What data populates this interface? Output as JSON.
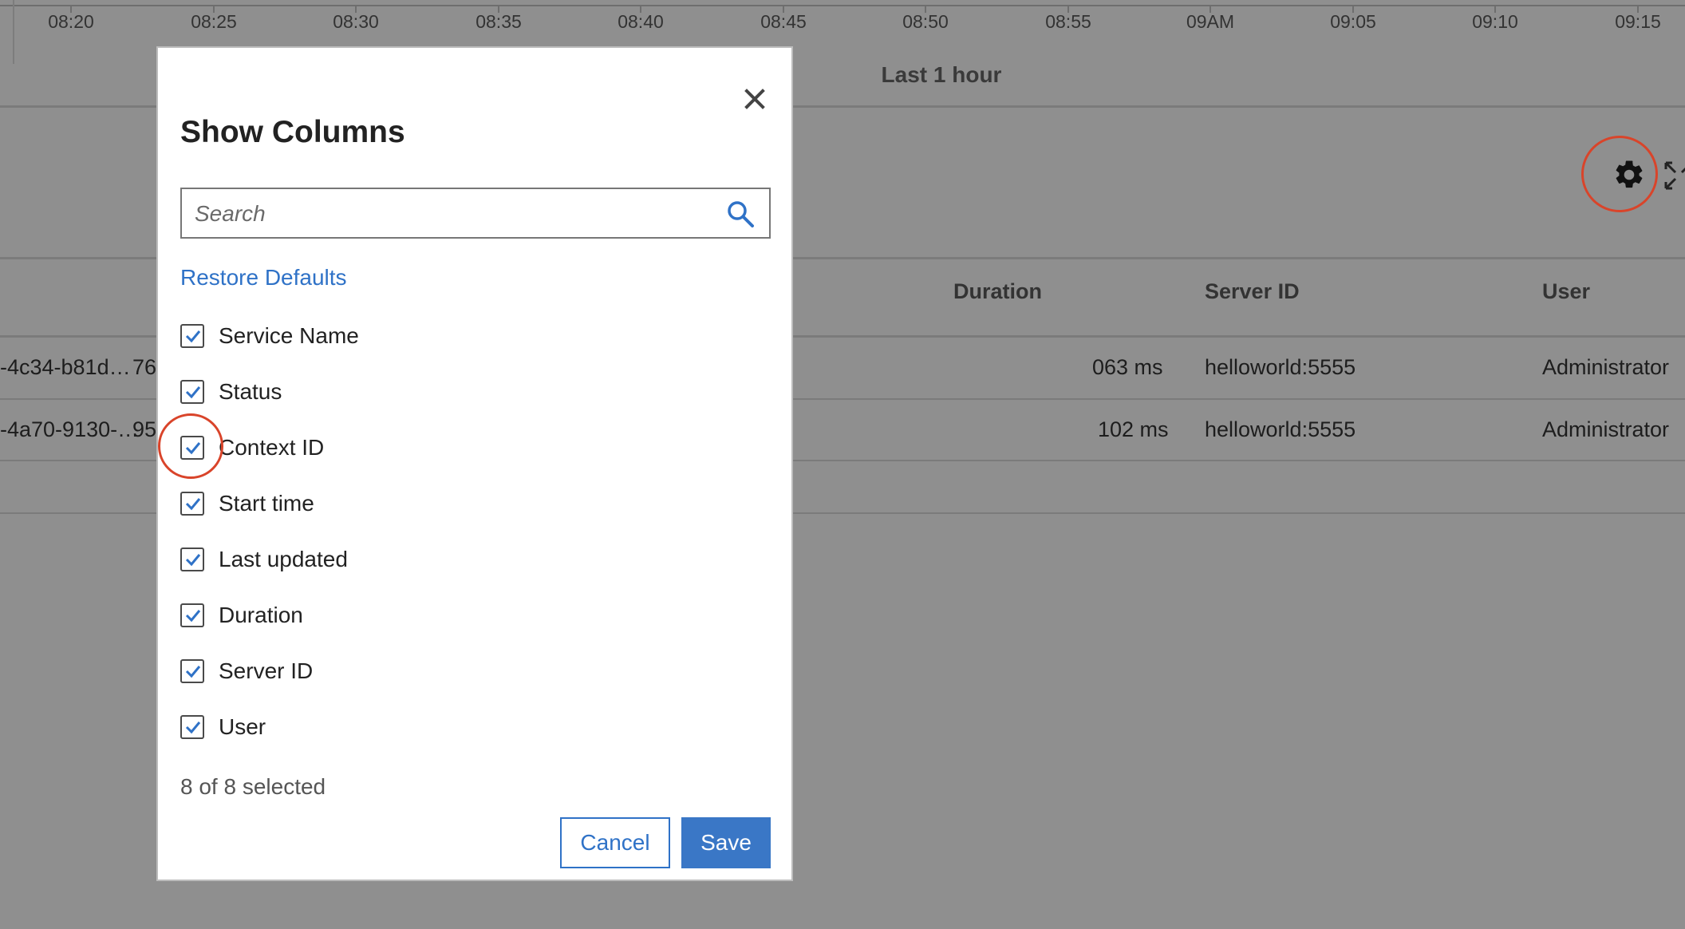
{
  "timeline": {
    "ticks": [
      "08:20",
      "08:25",
      "08:30",
      "08:35",
      "08:40",
      "08:45",
      "08:50",
      "08:55",
      "09AM",
      "09:05",
      "09:10",
      "09:15"
    ],
    "range_label": "Last 1 hour"
  },
  "table": {
    "headers": [
      "Duration",
      "Server ID",
      "User"
    ],
    "rows": [
      {
        "context_id": "-4c34-b81d…",
        "start": "76",
        "duration": "063 ms",
        "server_id": "helloworld:5555",
        "user": "Administrator"
      },
      {
        "context_id": "-4a70-9130-…",
        "start": "95",
        "duration": "102 ms",
        "server_id": "helloworld:5555",
        "user": "Administrator"
      }
    ]
  },
  "modal": {
    "title": "Show Columns",
    "search_placeholder": "Search",
    "restore_label": "Restore Defaults",
    "columns": [
      {
        "label": "Service Name",
        "checked": true
      },
      {
        "label": "Status",
        "checked": true
      },
      {
        "label": "Context ID",
        "checked": true
      },
      {
        "label": "Start time",
        "checked": true
      },
      {
        "label": "Last updated",
        "checked": true
      },
      {
        "label": "Duration",
        "checked": true
      },
      {
        "label": "Server ID",
        "checked": true
      },
      {
        "label": "User",
        "checked": true
      }
    ],
    "selected_count": "8 of 8 selected",
    "cancel_label": "Cancel",
    "save_label": "Save"
  },
  "colors": {
    "accent": "#2f72c7",
    "highlight": "#d9442a",
    "overlay": "#8f8f8f"
  },
  "icons": [
    "gear-icon",
    "expand-icon",
    "close-icon",
    "search-icon",
    "check-icon"
  ]
}
